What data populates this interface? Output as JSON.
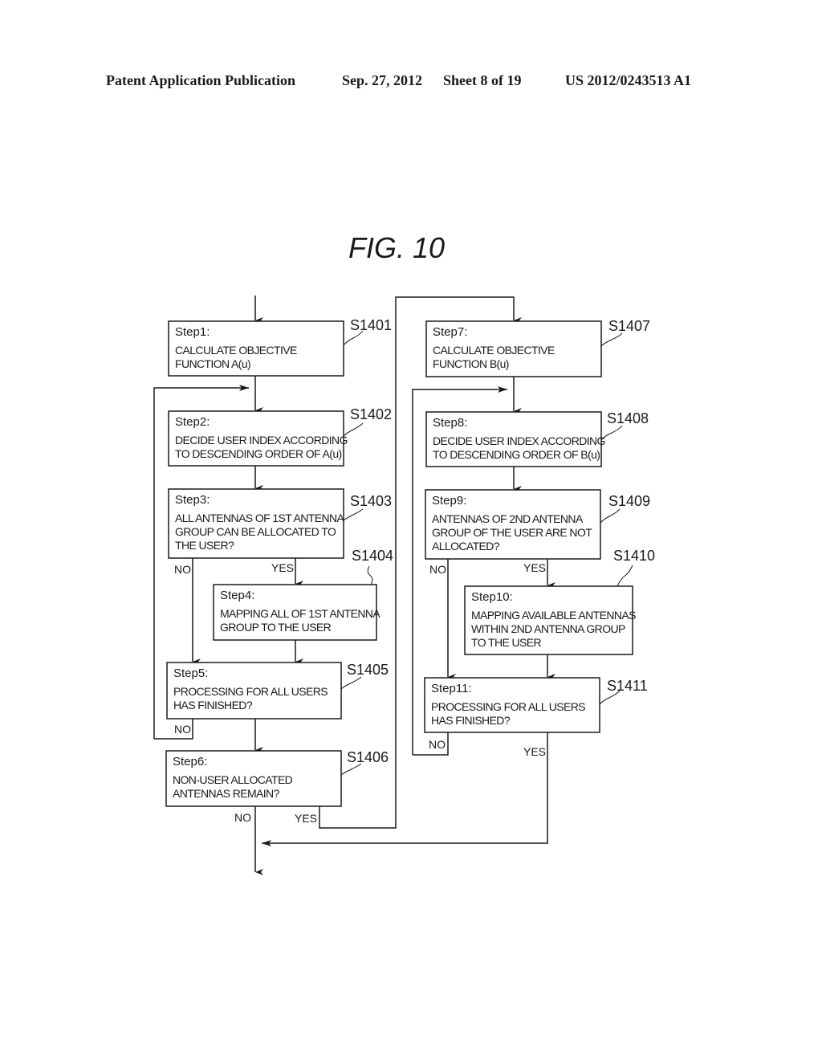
{
  "header": {
    "publication": "Patent Application Publication",
    "date": "Sep. 27, 2012",
    "sheet": "Sheet 8 of 19",
    "number": "US 2012/0243513 A1"
  },
  "figure": {
    "title": "FIG.  10"
  },
  "steps": [
    {
      "ref": "S1401",
      "title": "Step1:",
      "lines": [
        "CALCULATE OBJECTIVE",
        "FUNCTION A(u)"
      ]
    },
    {
      "ref": "S1402",
      "title": "Step2:",
      "lines": [
        "DECIDE USER INDEX ACCORDING",
        "TO DESCENDING ORDER OF A(u)"
      ]
    },
    {
      "ref": "S1403",
      "title": "Step3:",
      "lines": [
        "ALL ANTENNAS OF 1ST ANTENNA",
        "GROUP CAN BE ALLOCATED TO",
        "THE USER?"
      ]
    },
    {
      "ref": "S1404",
      "title": "Step4:",
      "lines": [
        "MAPPING ALL OF 1ST ANTENNA",
        "GROUP TO THE USER"
      ]
    },
    {
      "ref": "S1405",
      "title": "Step5:",
      "lines": [
        "PROCESSING FOR ALL USERS",
        "HAS FINISHED?"
      ]
    },
    {
      "ref": "S1406",
      "title": "Step6:",
      "lines": [
        "NON-USER ALLOCATED",
        "ANTENNAS REMAIN?"
      ]
    },
    {
      "ref": "S1407",
      "title": "Step7:",
      "lines": [
        "CALCULATE OBJECTIVE",
        "FUNCTION B(u)"
      ]
    },
    {
      "ref": "S1408",
      "title": "Step8:",
      "lines": [
        "DECIDE USER INDEX ACCORDING",
        "TO DESCENDING ORDER OF B(u)"
      ]
    },
    {
      "ref": "S1409",
      "title": "Step9:",
      "lines": [
        "ANTENNAS OF 2ND ANTENNA",
        "GROUP OF THE USER ARE NOT",
        "ALLOCATED?"
      ]
    },
    {
      "ref": "S1410",
      "title": "Step10:",
      "lines": [
        "MAPPING AVAILABLE ANTENNAS",
        "WITHIN 2ND ANTENNA GROUP",
        "TO THE USER"
      ]
    },
    {
      "ref": "S1411",
      "title": "Step11:",
      "lines": [
        "PROCESSING FOR ALL USERS",
        "HAS FINISHED?"
      ]
    }
  ],
  "branch_labels": {
    "s3_no": "NO",
    "s3_yes": "YES",
    "s5_no": "NO",
    "s6_no": "NO",
    "s6_yes": "YES",
    "s9_no": "NO",
    "s9_yes": "YES",
    "s11_no": "NO",
    "s11_yes": "YES"
  }
}
